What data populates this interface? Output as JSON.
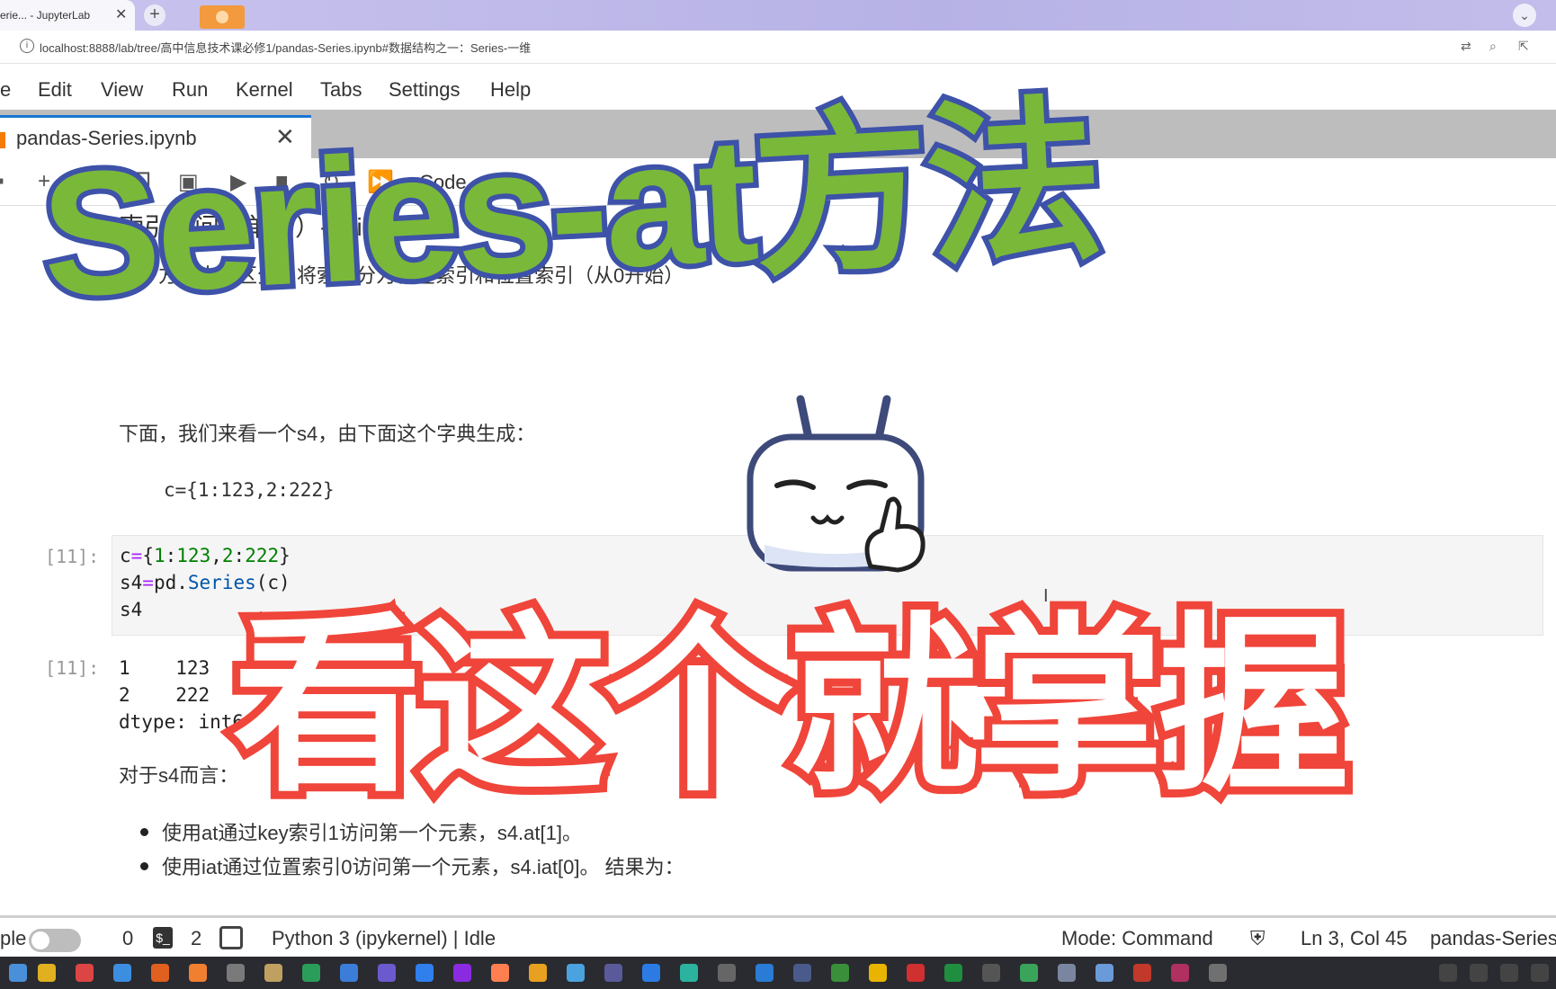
{
  "browser": {
    "tab_title": "erie... - JupyterLab",
    "tab_close": "✕",
    "new_tab": "+",
    "url": "localhost:8888/lab/tree/高中信息技术课必修1/pandas-Series.ipynb#数据结构之一：Series-一维"
  },
  "menu": {
    "items": [
      "e",
      "Edit",
      "View",
      "Run",
      "Kernel",
      "Tabs",
      "Settings",
      "Help"
    ]
  },
  "notebook_tab": {
    "name": "pandas-Series.ipynb",
    "close": "✕"
  },
  "toolbar": {
    "cell_type": "Code",
    "icons": [
      "save-icon",
      "add-cell-icon",
      "cut-icon",
      "copy-icon",
      "paste-icon",
      "run-icon",
      "stop-icon",
      "restart-icon",
      "run-all-icon"
    ]
  },
  "content": {
    "heading": "索引访问（单个）-at/iat方法",
    "para1": "为了方便大家区分，将索引分为标签索引和位置索引（从0开始）",
    "para2": "下面，我们来看一个s4，由下面这个字典生成：",
    "dict_code": "c={1:123,2:222}",
    "cell_prompt": "[11]:",
    "code_lines": [
      "c={1:123,2:222}",
      "s4=pd.Series(c)",
      "s4"
    ],
    "output_prompt": "[11]:",
    "output_lines": [
      "1    123",
      "2    222",
      "dtype: int64"
    ],
    "para3": "对于s4而言：",
    "bullet1": "使用at通过key索引1访问第一个元素，s4.at[1]。",
    "bullet2": "使用iat通过位置索引0访问第一个元素，s4.iat[0]。 结果为："
  },
  "status": {
    "simple_label": "ple",
    "count_terminals": "0",
    "count_kernels": "2",
    "kernel": "Python 3 (ipykernel) | Idle",
    "mode": "Mode: Command",
    "position": "Ln 3, Col 45",
    "file": "pandas-Series"
  },
  "overlay": {
    "title_line1": "Series-at方法",
    "title_line2": "看这个就掌握"
  },
  "colors": {
    "green_text": "#7ab83a",
    "blue_stroke": "#3d52a8",
    "red_stroke": "#f0453a",
    "jupyter_blue": "#1976d2"
  }
}
